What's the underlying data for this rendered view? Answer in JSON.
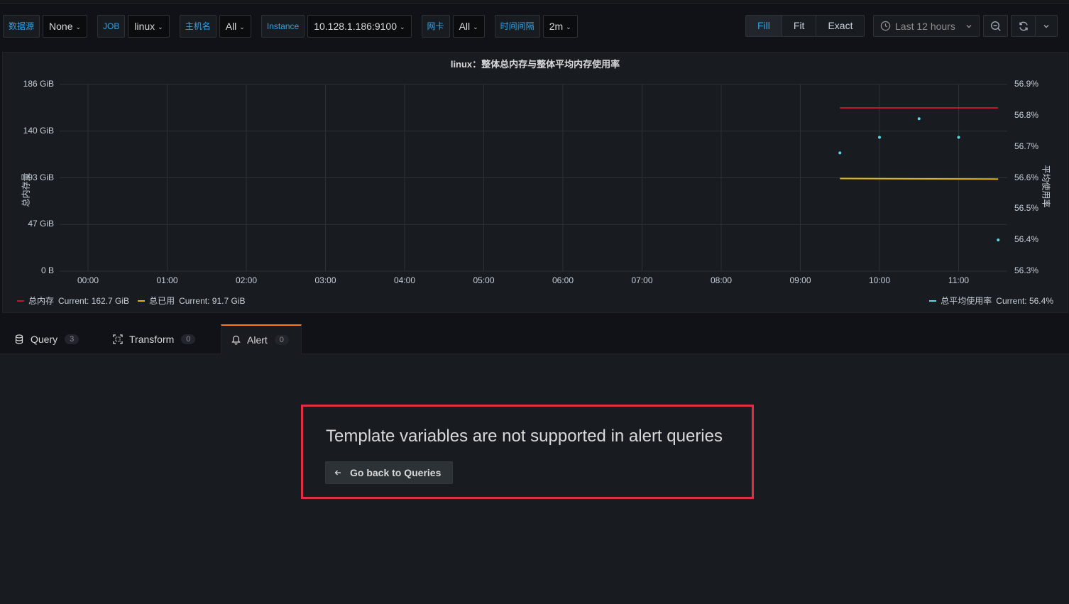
{
  "variables": [
    {
      "label": "数据源",
      "value": "None"
    },
    {
      "label": "JOB",
      "value": "linux"
    },
    {
      "label": "主机名",
      "value": "All"
    },
    {
      "label": "Instance",
      "value": "10.128.1.186:9100"
    },
    {
      "label": "网卡",
      "value": "All"
    },
    {
      "label": "时间间隔",
      "value": "2m"
    }
  ],
  "modes": {
    "fill": "Fill",
    "fit": "Fit",
    "exact": "Exact",
    "active": "Fill"
  },
  "timepicker": {
    "label": "Last 12 hours",
    "icon": "clock-icon"
  },
  "buttons": {
    "zoom_out_icon": "zoom-out-icon",
    "refresh_icon": "refresh-icon",
    "dropdown_icon": "chevron-down-icon"
  },
  "panel": {
    "title": "linux：整体总内存与整体平均内存使用率"
  },
  "chart_data": {
    "type": "line",
    "title": "linux：整体总内存与整体平均内存使用率",
    "x_ticks": [
      "00:00",
      "01:00",
      "02:00",
      "03:00",
      "04:00",
      "05:00",
      "06:00",
      "07:00",
      "08:00",
      "09:00",
      "10:00",
      "11:00"
    ],
    "y_left": {
      "label": "总内存量",
      "ticks": [
        "0 B",
        "47 GiB",
        "93 GiB",
        "140 GiB",
        "186 GiB"
      ],
      "range_gib": [
        0,
        186
      ]
    },
    "y_right": {
      "label": "平均使用率",
      "ticks": [
        "56.3%",
        "56.4%",
        "56.5%",
        "56.6%",
        "56.7%",
        "56.8%",
        "56.9%"
      ],
      "range_pct": [
        56.3,
        56.9
      ]
    },
    "grid": true,
    "series": [
      {
        "name": "总内存",
        "axis": "left",
        "color": "#c4162a",
        "style": "line",
        "x_hours": [
          9.5,
          11.5
        ],
        "values_gib": [
          162.7,
          162.7
        ],
        "current": "Current: 162.7 GiB"
      },
      {
        "name": "总已用",
        "axis": "left",
        "color": "#e0b400",
        "style": "line",
        "x_hours": [
          9.5,
          11.5
        ],
        "values_gib": [
          92.3,
          91.7
        ],
        "current": "Current: 91.7 GiB"
      },
      {
        "name": "总平均使用率",
        "axis": "right",
        "color": "#5ad8e6",
        "style": "points",
        "x_hours": [
          9.5,
          10.0,
          10.5,
          11.0,
          11.5
        ],
        "values_pct": [
          56.68,
          56.73,
          56.79,
          56.73,
          56.4
        ],
        "current": "Current: 56.4%"
      }
    ],
    "legend_placement": "bottom"
  },
  "tabs": [
    {
      "label": "Query",
      "count": "3",
      "icon": "database-icon"
    },
    {
      "label": "Transform",
      "count": "0",
      "icon": "transform-icon"
    },
    {
      "label": "Alert",
      "count": "0",
      "icon": "bell-icon",
      "active": true
    }
  ],
  "alert": {
    "message": "Template variables are not supported in alert queries",
    "back_button": "Go back to Queries",
    "back_icon": "arrow-left-icon"
  }
}
